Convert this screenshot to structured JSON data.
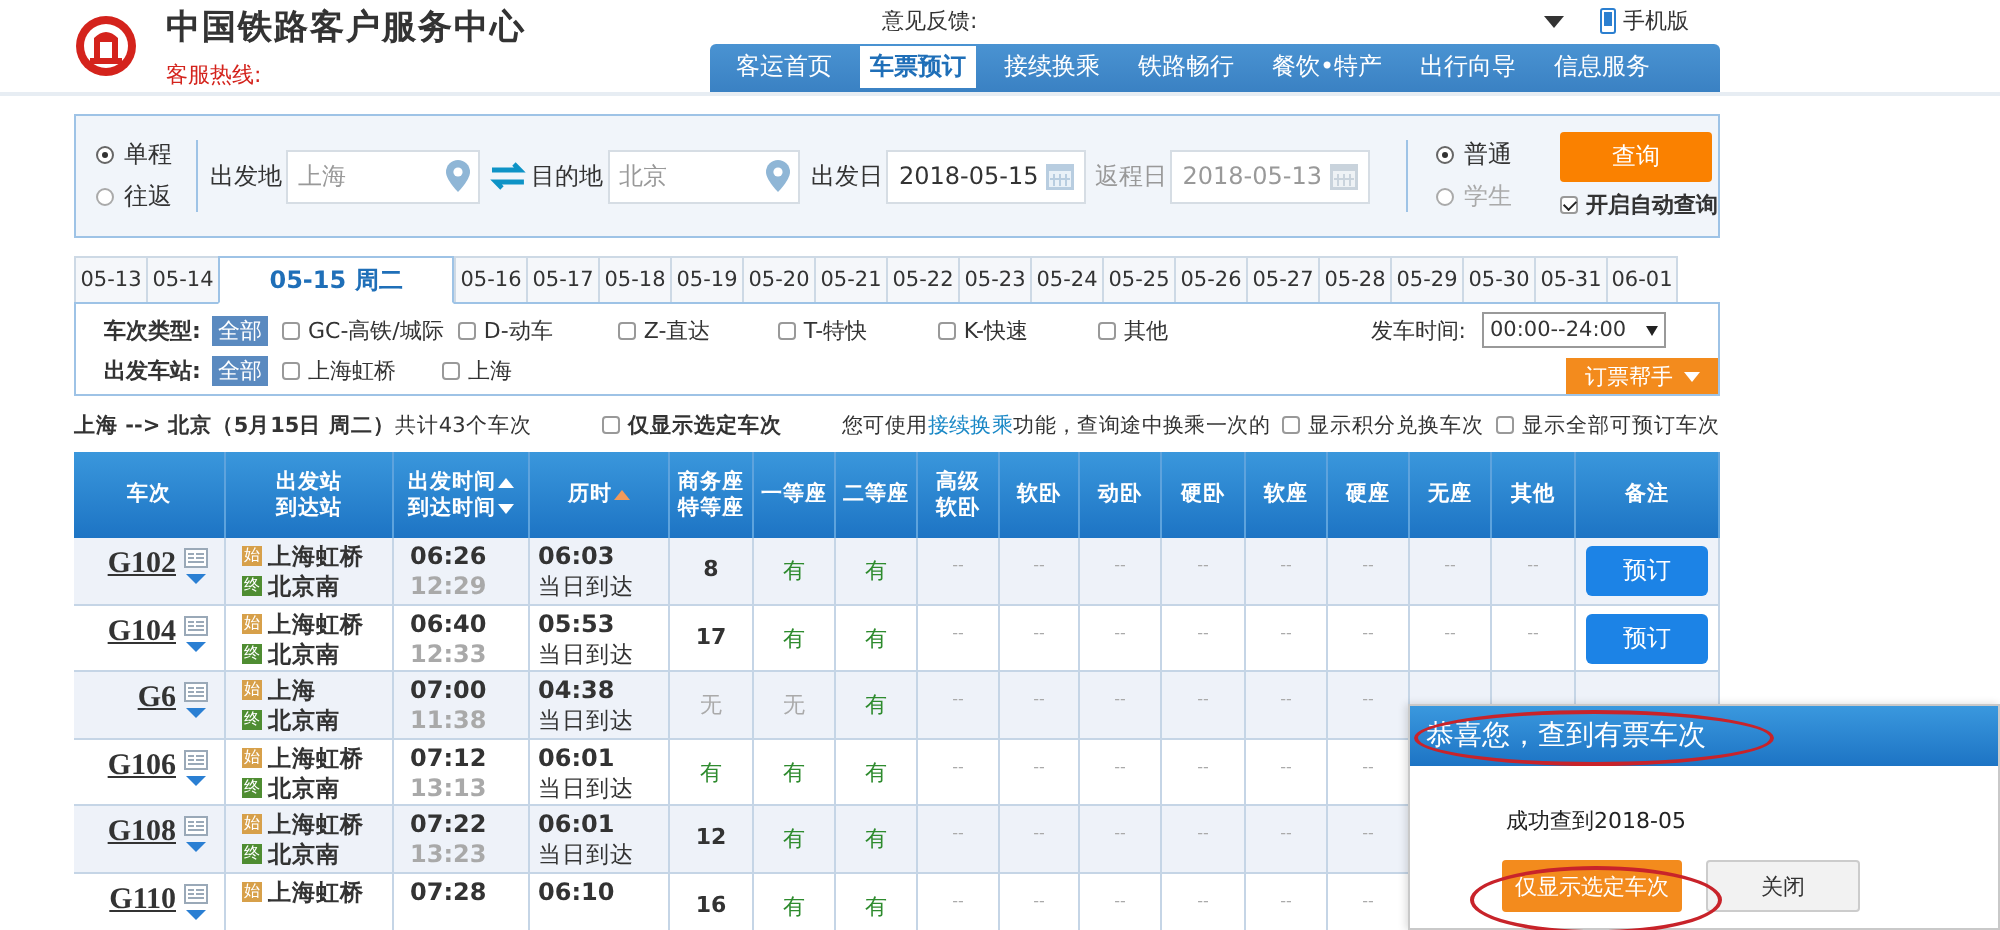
{
  "header": {
    "site_title": "中国铁路客户服务中心",
    "hotline_label": "客服热线:",
    "feedback_label": "意见反馈:",
    "mobile_link": "手机版"
  },
  "nav": [
    {
      "label": "客运首页",
      "selected": false
    },
    {
      "label": "车票预订",
      "selected": true
    },
    {
      "label": "接续换乘",
      "selected": false
    },
    {
      "label": "铁路畅行",
      "selected": false
    },
    {
      "label": "餐饮•特产",
      "selected": false
    },
    {
      "label": "出行向导",
      "selected": false
    },
    {
      "label": "信息服务",
      "selected": false
    }
  ],
  "search": {
    "trip_types": [
      {
        "label": "单程",
        "selected": true
      },
      {
        "label": "往返",
        "selected": false
      }
    ],
    "from": {
      "label": "出发地",
      "value": "上海"
    },
    "to": {
      "label": "目的地",
      "value": "北京"
    },
    "depart": {
      "label": "出发日",
      "value": "2018-05-15",
      "disabled": false
    },
    "return": {
      "label": "返程日",
      "value": "2018-05-13",
      "disabled": true
    },
    "passenger_types": [
      {
        "label": "普通",
        "selected": true,
        "disabled": false
      },
      {
        "label": "学生",
        "selected": false,
        "disabled": true
      }
    ],
    "query_button": "查询",
    "auto_query": {
      "label": "开启自动查询",
      "checked": true
    }
  },
  "date_tabs": [
    {
      "label": "05-13",
      "selected": false
    },
    {
      "label": "05-14",
      "selected": false
    },
    {
      "label": "05-15 周二",
      "selected": true
    },
    {
      "label": "05-16",
      "selected": false
    },
    {
      "label": "05-17",
      "selected": false
    },
    {
      "label": "05-18",
      "selected": false
    },
    {
      "label": "05-19",
      "selected": false
    },
    {
      "label": "05-20",
      "selected": false
    },
    {
      "label": "05-21",
      "selected": false
    },
    {
      "label": "05-22",
      "selected": false
    },
    {
      "label": "05-23",
      "selected": false
    },
    {
      "label": "05-24",
      "selected": false
    },
    {
      "label": "05-25",
      "selected": false
    },
    {
      "label": "05-26",
      "selected": false
    },
    {
      "label": "05-27",
      "selected": false
    },
    {
      "label": "05-28",
      "selected": false
    },
    {
      "label": "05-29",
      "selected": false
    },
    {
      "label": "05-30",
      "selected": false
    },
    {
      "label": "05-31",
      "selected": false
    },
    {
      "label": "06-01",
      "selected": false
    }
  ],
  "filters": {
    "train_type": {
      "label": "车次类型:",
      "all": {
        "label": "全部",
        "selected": true
      },
      "options": [
        {
          "label": "GC-高铁/城际",
          "checked": false
        },
        {
          "label": "D-动车",
          "checked": false
        },
        {
          "label": "Z-直达",
          "checked": false
        },
        {
          "label": "T-特快",
          "checked": false
        },
        {
          "label": "K-快速",
          "checked": false
        },
        {
          "label": "其他",
          "checked": false
        }
      ]
    },
    "depart_station": {
      "label": "出发车站:",
      "all": {
        "label": "全部",
        "selected": true
      },
      "options": [
        {
          "label": "上海虹桥",
          "checked": false
        },
        {
          "label": "上海",
          "checked": false
        }
      ]
    },
    "depart_time": {
      "label": "发车时间:",
      "value": "00:00--24:00"
    },
    "helper_button": "订票帮手"
  },
  "summary": {
    "text": "**上海 --> 北京（5月15日  周二）**共计43个车次",
    "only_selected": {
      "label": "仅显示选定车次",
      "checked": false
    },
    "note_before": "您可使用",
    "note_link": "接续换乘",
    "note_after": "功能，查询途中换乘一次的",
    "options": [
      {
        "label": "显示积分兑换车次",
        "checked": false
      },
      {
        "label": "显示全部可预订车次",
        "checked": false
      }
    ]
  },
  "table": {
    "columns": [
      {
        "lines": [
          {
            "text": "车次"
          }
        ]
      },
      {
        "lines": [
          {
            "text": "出发站"
          },
          {
            "text": "到达站"
          }
        ]
      },
      {
        "lines": [
          {
            "text": "出发时间",
            "sort_up": true
          },
          {
            "text": "到达时间",
            "sort_down": true
          }
        ]
      },
      {
        "lines": [
          {
            "text": "历时",
            "sort_up": true,
            "sort_active": true
          }
        ]
      },
      {
        "lines": [
          {
            "text": "商务座"
          },
          {
            "text": "特等座"
          }
        ]
      },
      {
        "lines": [
          {
            "text": "一等座"
          }
        ]
      },
      {
        "lines": [
          {
            "text": "二等座"
          }
        ]
      },
      {
        "lines": [
          {
            "text": "高级"
          },
          {
            "text": "软卧"
          }
        ]
      },
      {
        "lines": [
          {
            "text": "软卧"
          }
        ]
      },
      {
        "lines": [
          {
            "text": "动卧"
          }
        ]
      },
      {
        "lines": [
          {
            "text": "硬卧"
          }
        ]
      },
      {
        "lines": [
          {
            "text": "软座"
          }
        ]
      },
      {
        "lines": [
          {
            "text": "硬座"
          }
        ]
      },
      {
        "lines": [
          {
            "text": "无座"
          }
        ]
      },
      {
        "lines": [
          {
            "text": "其他"
          }
        ]
      },
      {
        "lines": [
          {
            "text": "备注"
          }
        ]
      }
    ],
    "rows": [
      {
        "train": "G102",
        "from_badge": "始",
        "from": "上海虹桥",
        "to_badge": "终",
        "to": "北京南",
        "depart": "06:26",
        "arrive": "12:29",
        "duration": "06:03",
        "arrival_day": "当日到达",
        "seats": [
          {
            "text": "8",
            "kind": "count"
          },
          {
            "text": "有",
            "kind": "yes"
          },
          {
            "text": "有",
            "kind": "yes"
          },
          {
            "text": "--",
            "kind": "dash"
          },
          {
            "text": "--",
            "kind": "dash"
          },
          {
            "text": "--",
            "kind": "dash"
          },
          {
            "text": "--",
            "kind": "dash"
          },
          {
            "text": "--",
            "kind": "dash"
          },
          {
            "text": "--",
            "kind": "dash"
          },
          {
            "text": "--",
            "kind": "dash"
          },
          {
            "text": "--",
            "kind": "dash"
          }
        ],
        "book": "预订"
      },
      {
        "train": "G104",
        "from_badge": "始",
        "from": "上海虹桥",
        "to_badge": "终",
        "to": "北京南",
        "depart": "06:40",
        "arrive": "12:33",
        "duration": "05:53",
        "arrival_day": "当日到达",
        "seats": [
          {
            "text": "17",
            "kind": "count"
          },
          {
            "text": "有",
            "kind": "yes"
          },
          {
            "text": "有",
            "kind": "yes"
          },
          {
            "text": "--",
            "kind": "dash"
          },
          {
            "text": "--",
            "kind": "dash"
          },
          {
            "text": "--",
            "kind": "dash"
          },
          {
            "text": "--",
            "kind": "dash"
          },
          {
            "text": "--",
            "kind": "dash"
          },
          {
            "text": "--",
            "kind": "dash"
          },
          {
            "text": "--",
            "kind": "dash"
          },
          {
            "text": "--",
            "kind": "dash"
          }
        ],
        "book": "预订"
      },
      {
        "train": "G6",
        "from_badge": "始",
        "from": "上海",
        "to_badge": "终",
        "to": "北京南",
        "depart": "07:00",
        "arrive": "11:38",
        "duration": "04:38",
        "arrival_day": "当日到达",
        "seats": [
          {
            "text": "无",
            "kind": "none"
          },
          {
            "text": "无",
            "kind": "none"
          },
          {
            "text": "有",
            "kind": "yes"
          },
          {
            "text": "--",
            "kind": "dash"
          },
          {
            "text": "--",
            "kind": "dash"
          },
          {
            "text": "--",
            "kind": "dash"
          },
          {
            "text": "--",
            "kind": "dash"
          },
          {
            "text": "--",
            "kind": "dash"
          },
          {
            "text": "--",
            "kind": "dash"
          }
        ]
      },
      {
        "train": "G106",
        "from_badge": "始",
        "from": "上海虹桥",
        "to_badge": "终",
        "to": "北京南",
        "depart": "07:12",
        "arrive": "13:13",
        "duration": "06:01",
        "arrival_day": "当日到达",
        "seats": [
          {
            "text": "有",
            "kind": "yes"
          },
          {
            "text": "有",
            "kind": "yes"
          },
          {
            "text": "有",
            "kind": "yes"
          },
          {
            "text": "--",
            "kind": "dash"
          },
          {
            "text": "--",
            "kind": "dash"
          },
          {
            "text": "--",
            "kind": "dash"
          },
          {
            "text": "--",
            "kind": "dash"
          },
          {
            "text": "--",
            "kind": "dash"
          },
          {
            "text": "--",
            "kind": "dash"
          }
        ]
      },
      {
        "train": "G108",
        "from_badge": "始",
        "from": "上海虹桥",
        "to_badge": "终",
        "to": "北京南",
        "depart": "07:22",
        "arrive": "13:23",
        "duration": "06:01",
        "arrival_day": "当日到达",
        "seats": [
          {
            "text": "12",
            "kind": "count"
          },
          {
            "text": "有",
            "kind": "yes"
          },
          {
            "text": "有",
            "kind": "yes"
          },
          {
            "text": "--",
            "kind": "dash"
          },
          {
            "text": "--",
            "kind": "dash"
          },
          {
            "text": "--",
            "kind": "dash"
          },
          {
            "text": "--",
            "kind": "dash"
          },
          {
            "text": "--",
            "kind": "dash"
          },
          {
            "text": "--",
            "kind": "dash"
          }
        ]
      },
      {
        "train": "G110",
        "from_badge": "始",
        "from": "上海虹桥",
        "depart": "07:28",
        "duration": "06:10",
        "seats": [
          {
            "text": "16",
            "kind": "count"
          },
          {
            "text": "有",
            "kind": "yes"
          },
          {
            "text": "有",
            "kind": "yes"
          },
          {
            "text": "--",
            "kind": "dash"
          },
          {
            "text": "--",
            "kind": "dash"
          },
          {
            "text": "--",
            "kind": "dash"
          },
          {
            "text": "--",
            "kind": "dash"
          },
          {
            "text": "--",
            "kind": "dash"
          },
          {
            "text": "--",
            "kind": "dash"
          }
        ]
      }
    ]
  },
  "popup": {
    "title": "恭喜您，查到有票车次",
    "message": "成功查到2018-05",
    "primary_button": "仅显示选定车次",
    "close_button": "关闭",
    "highlighted": true
  }
}
